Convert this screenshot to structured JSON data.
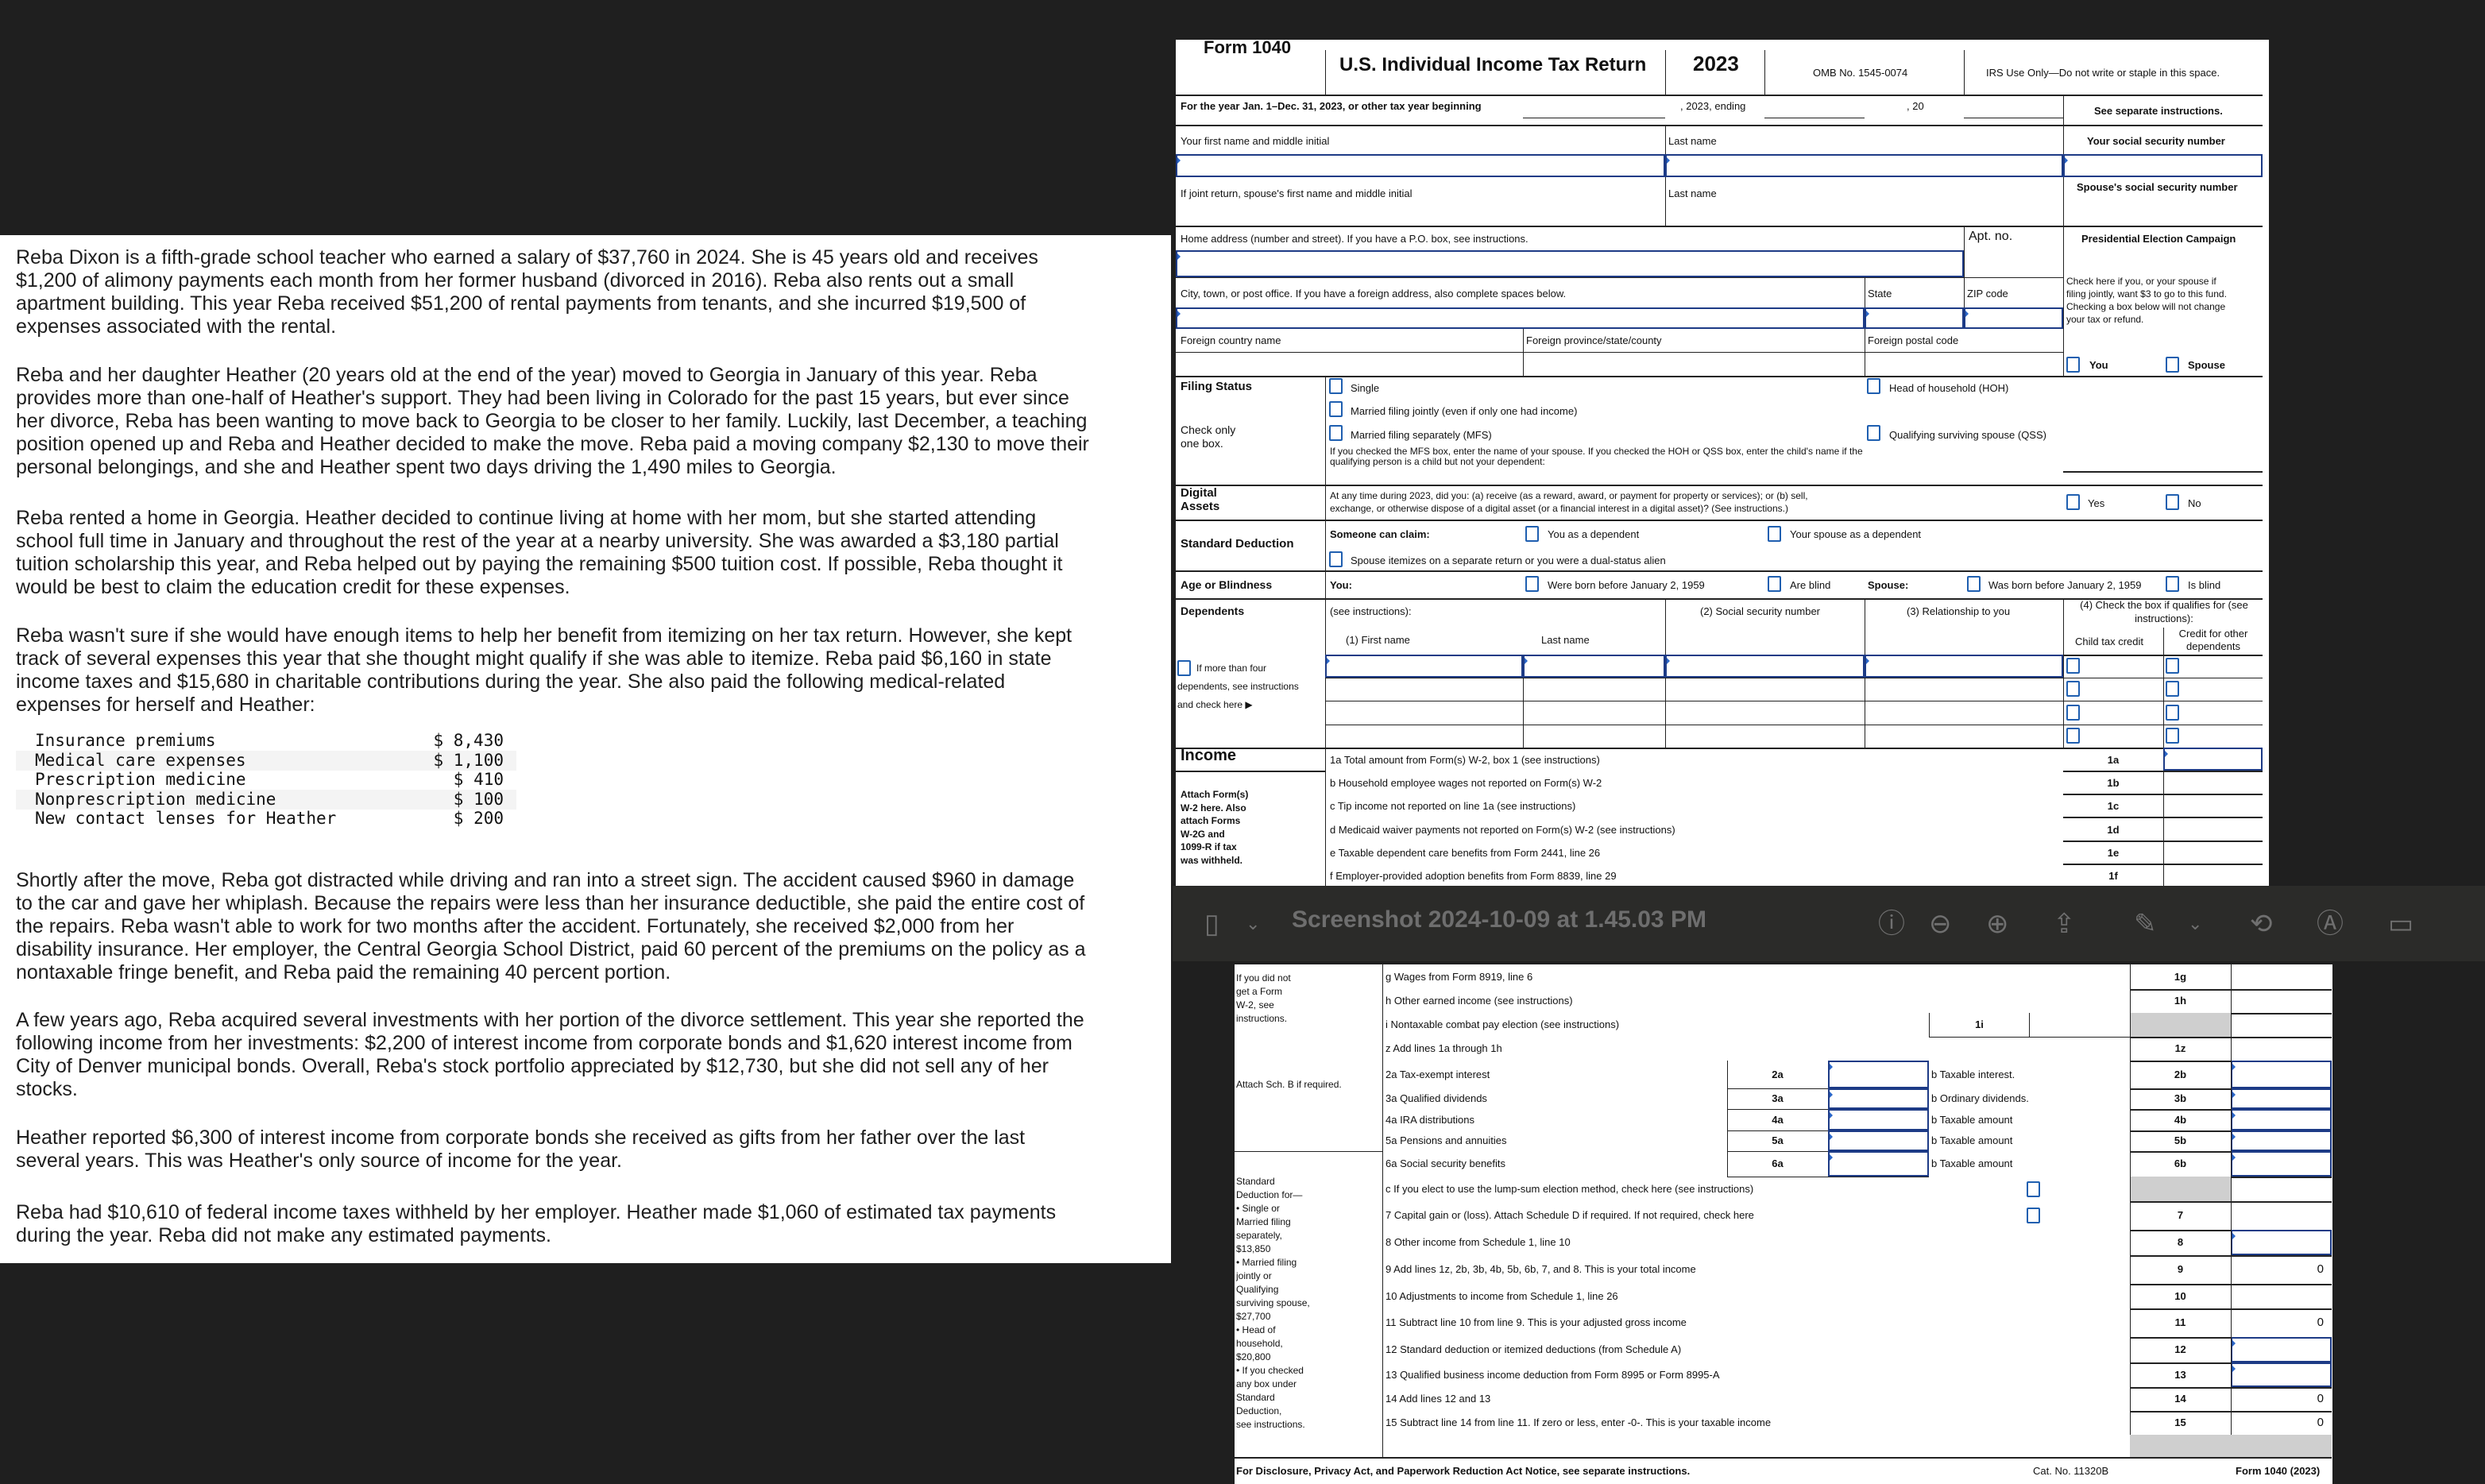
{
  "left": {
    "paragraphs": [
      [
        "Reba Dixon is a fifth-grade school teacher who earned a salary of $37,760 in 2024. She is 45 years old and receives",
        "$1,200 of alimony payments each month from her former husband (divorced in 2016). Reba also rents out a small",
        "apartment building. This year Reba received $51,200 of rental payments from tenants, and she incurred $19,500 of",
        "expenses associated with the rental."
      ],
      [
        "Reba and her daughter Heather (20 years old at the end of the year) moved to Georgia in January of this year. Reba",
        "provides more than one-half of Heather's support. They had been living in Colorado for the past 15 years, but ever since",
        "her divorce, Reba has been wanting to move back to Georgia to be closer to her family. Luckily, last December, a teaching",
        "position opened up and Reba and Heather decided to make the move. Reba paid a moving company $2,130 to move their",
        "personal belongings, and she and Heather spent two days driving the 1,490 miles to Georgia."
      ],
      [
        "Reba rented a home in Georgia. Heather decided to continue living at home with her mom, but she started attending",
        "school full time in January and throughout the rest of the year at a nearby university. She was awarded a $3,180 partial",
        "tuition scholarship this year, and Reba helped out by paying the remaining $500 tuition cost. If possible, Reba thought it",
        "would be best to claim the education credit for these expenses."
      ],
      [
        "Reba wasn't sure if she would have enough items to help her benefit from itemizing on her tax return. However, she kept",
        "track of several expenses this year that she thought might qualify if she was able to itemize. Reba paid $6,160 in state",
        "income taxes and $15,680 in charitable contributions during the year. She also paid the following medical-related",
        "expenses for herself and Heather:"
      ],
      [
        "Shortly after the move, Reba got distracted while driving and ran into a street sign. The accident caused $960 in damage",
        "to the car and gave her whiplash. Because the repairs were less than her insurance deductible, she paid the entire cost of",
        "the repairs. Reba wasn't able to work for two months after the accident. Fortunately, she received $2,000 from her",
        "disability insurance. Her employer, the Central Georgia School District, paid 60 percent of the premiums on the policy as a",
        "nontaxable fringe benefit, and Reba paid the remaining 40 percent portion."
      ],
      [
        "A few years ago, Reba acquired several investments with her portion of the divorce settlement. This year she reported the",
        "following income from her investments: $2,200 of interest income from corporate bonds and $1,620 interest income from",
        "City of Denver municipal bonds. Overall, Reba's stock portfolio appreciated by $12,730, but she did not sell any of her",
        "stocks."
      ],
      [
        "Heather reported $6,300 of interest income from corporate bonds she received as gifts from her father over the last",
        "several years. This was Heather's only source of income for the year."
      ],
      [
        "Reba had $10,610 of federal income taxes withheld by her employer. Heather made $1,060 of estimated tax payments",
        "during the year. Reba did not make any estimated payments."
      ]
    ],
    "expenses": [
      {
        "item": "Insurance premiums",
        "amount": "$ 8,430"
      },
      {
        "item": "Medical care expenses",
        "amount": "$ 1,100"
      },
      {
        "item": "Prescription medicine",
        "amount": "$ 410"
      },
      {
        "item": "Nonprescription medicine",
        "amount": "$ 100"
      },
      {
        "item": "New contact lenses for Heather",
        "amount": "$ 200"
      }
    ]
  },
  "toolbar": {
    "title": "Screenshot 2024-10-09 at 1.45.03 PM",
    "icons": [
      "sidebar-icon",
      "chevron-down-icon",
      "info-icon",
      "zoom-out-icon",
      "zoom-in-icon",
      "share-icon",
      "markup-pen-icon",
      "chevron-down-icon",
      "rotate-icon",
      "annotate-icon",
      "form-fill-icon"
    ]
  },
  "form": {
    "header": {
      "form_title": "Form 1040",
      "title": "U.S. Individual Income Tax Return",
      "year": "2023",
      "omb": "OMB No. 1545-0074",
      "irs_use": "IRS Use Only—Do not write or staple in this space."
    },
    "year_row": {
      "text": "For the year Jan. 1–Dec. 31, 2023, or other tax year beginning",
      "ending": ", 2023, ending",
      "twenty": ", 20",
      "see_instr": "See separate instructions."
    },
    "name": {
      "first_label": "Your first name and middle initial",
      "last_label": "Last name",
      "ssn_label": "Your social security number",
      "spouse_first_label": "If joint return, spouse's first name and middle initial",
      "spouse_last_label": "Last name",
      "spouse_ssn_label": "Spouse's social security number"
    },
    "address": {
      "home_label": "Home address (number and street). If you have a P.O. box, see instructions.",
      "apt_label": "Apt. no.",
      "pec_label": "Presidential Election Campaign",
      "city_label": "City, town, or post office. If you have a foreign address, also complete spaces below.",
      "state_label": "State",
      "zip_label": "ZIP code",
      "pec_text": [
        "Check here if you, or your spouse if",
        "filing jointly, want $3 to go to this fund.",
        "Checking a box below will not change",
        "your tax or refund."
      ],
      "foreign_country": "Foreign country name",
      "foreign_province": "Foreign province/state/county",
      "foreign_postal": "Foreign postal code",
      "you": "You",
      "spouse": "Spouse"
    },
    "filing": {
      "heading": "Filing Status",
      "check_only": [
        "Check only",
        "one box."
      ],
      "single": "Single",
      "mfj": "Married filing jointly (even if only one had income)",
      "hoh": "Head of household (HOH)",
      "mfs": "Married filing separately (MFS)",
      "qss": "Qualifying surviving spouse (QSS)",
      "note": [
        "If you checked the MFS box, enter the name of your spouse. If you checked the HOH or QSS box, enter the child's name if the",
        "qualifying person is a child but not your dependent:"
      ]
    },
    "digital": {
      "heading": [
        "Digital",
        "Assets"
      ],
      "question": [
        "At any time during 2023, did you: (a) receive (as a reward, award, or payment for property or services); or (b) sell,",
        "exchange, or otherwise dispose of a digital asset (or a financial interest in a digital asset)? (See instructions.)"
      ],
      "yes": "Yes",
      "no": "No"
    },
    "std": {
      "heading": "Standard Deduction",
      "someone": "Someone can claim:",
      "you_dep": "You as a dependent",
      "spouse_dep": "Your spouse as a dependent",
      "spouse_itemizes": "Spouse itemizes on a separate return or you were a dual-status alien"
    },
    "age": {
      "heading": "Age or Blindness",
      "you": "You:",
      "born": "Were born before January 2, 1959",
      "blind": "Are blind",
      "spouse": "Spouse:",
      "s_born": "Was born before January 2, 1959",
      "s_blind": "Is blind"
    },
    "dep": {
      "heading": "Dependents",
      "see_instr": "(see instructions):",
      "ssn": "(2) Social security number",
      "rel": "(3) Relationship to you",
      "check4": [
        "(4) Check the box if qualifies for (see",
        "instructions):"
      ],
      "first": "(1) First name",
      "last": "Last name",
      "ctc": "Child tax credit",
      "odc": [
        "Credit for other",
        "dependents"
      ],
      "more": [
        "If more than four",
        "dependents, see instructions",
        "and check here ▶"
      ]
    },
    "income": {
      "heading": "Income",
      "attach": [
        "Attach Form(s)",
        "W-2 here. Also",
        "attach Forms",
        "W-2G and",
        "1099-R if tax",
        "was withheld."
      ],
      "lines": [
        {
          "num": "1a",
          "text": "1a Total amount from Form(s) W-2, box 1 (see instructions)"
        },
        {
          "num": "1b",
          "text": "b Household employee wages not reported on Form(s) W-2"
        },
        {
          "num": "1c",
          "text": "c Tip income not reported on line 1a (see instructions)"
        },
        {
          "num": "1d",
          "text": "d Medicaid waiver payments not reported on Form(s) W-2 (see instructions)"
        },
        {
          "num": "1e",
          "text": "e Taxable dependent care benefits from Form 2441, line 26"
        },
        {
          "num": "1f",
          "text": "f Employer-provided adoption benefits from Form 8839, line 29"
        }
      ]
    }
  },
  "page2": {
    "side_w2": [
      "If you did not",
      "get a Form",
      "W-2, see",
      "instructions."
    ],
    "side_schb": "Attach Sch. B if required.",
    "side_std": [
      "Standard",
      "Deduction for—",
      "• Single or",
      "Married filing",
      "separately,",
      "$13,850",
      "• Married filing",
      "jointly or",
      "Qualifying",
      "surviving spouse,",
      "$27,700",
      "• Head of",
      "household,",
      "$20,800",
      "• If you checked",
      "any box under",
      "Standard",
      "Deduction,",
      "see instructions."
    ],
    "lines": [
      {
        "text": "g Wages from Form 8919, line 6",
        "num": "1g",
        "value": ""
      },
      {
        "text": "h Other earned income (see instructions)",
        "num": "1h",
        "value": ""
      },
      {
        "text": "i Nontaxable combat pay election (see instructions)",
        "mid": "1i",
        "num": "",
        "value": ""
      },
      {
        "text": "z Add lines 1a through 1h",
        "num": "1z",
        "value": ""
      },
      {
        "text": "2a Tax-exempt interest",
        "mid": "2a",
        "btext": "b Taxable interest.",
        "num": "2b",
        "value": ""
      },
      {
        "text": "3a Qualified dividends",
        "mid": "3a",
        "btext": "b Ordinary dividends.",
        "num": "3b",
        "value": ""
      },
      {
        "text": "4a IRA distributions",
        "mid": "4a",
        "btext": "b Taxable amount",
        "num": "4b",
        "value": ""
      },
      {
        "text": "5a Pensions and annuities",
        "mid": "5a",
        "btext": "b Taxable amount",
        "num": "5b",
        "value": ""
      },
      {
        "text": "6a Social security benefits",
        "mid": "6a",
        "btext": "b Taxable amount",
        "num": "6b",
        "value": ""
      },
      {
        "text": "c If you elect to use the lump-sum election method, check here (see instructions)",
        "num": "",
        "value": ""
      },
      {
        "text": "7 Capital gain or (loss). Attach Schedule D if required. If not required, check here",
        "num": "7",
        "value": ""
      },
      {
        "text": "8 Other income from Schedule 1, line 10",
        "num": "8",
        "value": ""
      },
      {
        "text": "9 Add lines 1z, 2b, 3b, 4b, 5b, 6b, 7, and 8. This is your total income",
        "num": "9",
        "value": "0"
      },
      {
        "text": "10 Adjustments to income from Schedule 1, line 26",
        "num": "10",
        "value": ""
      },
      {
        "text": "11 Subtract line 10 from line 9. This is your adjusted gross income",
        "num": "11",
        "value": "0"
      },
      {
        "text": "12 Standard deduction or itemized deductions (from Schedule A)",
        "num": "12",
        "value": ""
      },
      {
        "text": "13 Qualified business income deduction from Form 8995 or Form 8995-A",
        "num": "13",
        "value": ""
      },
      {
        "text": "14 Add lines 12 and 13",
        "num": "14",
        "value": "0"
      },
      {
        "text": "15 Subtract line 14 from line 11. If zero or less, enter -0-. This is your taxable income",
        "num": "15",
        "value": "0"
      }
    ],
    "footer_disclosure": "For Disclosure, Privacy Act, and Paperwork Reduction Act Notice, see separate instructions.",
    "cat_no": "Cat. No. 11320B",
    "form_footer": "Form 1040 (2023)"
  },
  "colors": {
    "checkbox": "#1f5fb0",
    "input_border": "#1d3b86",
    "toolbar": "#2b2b29",
    "background": "#1f1f1f"
  }
}
